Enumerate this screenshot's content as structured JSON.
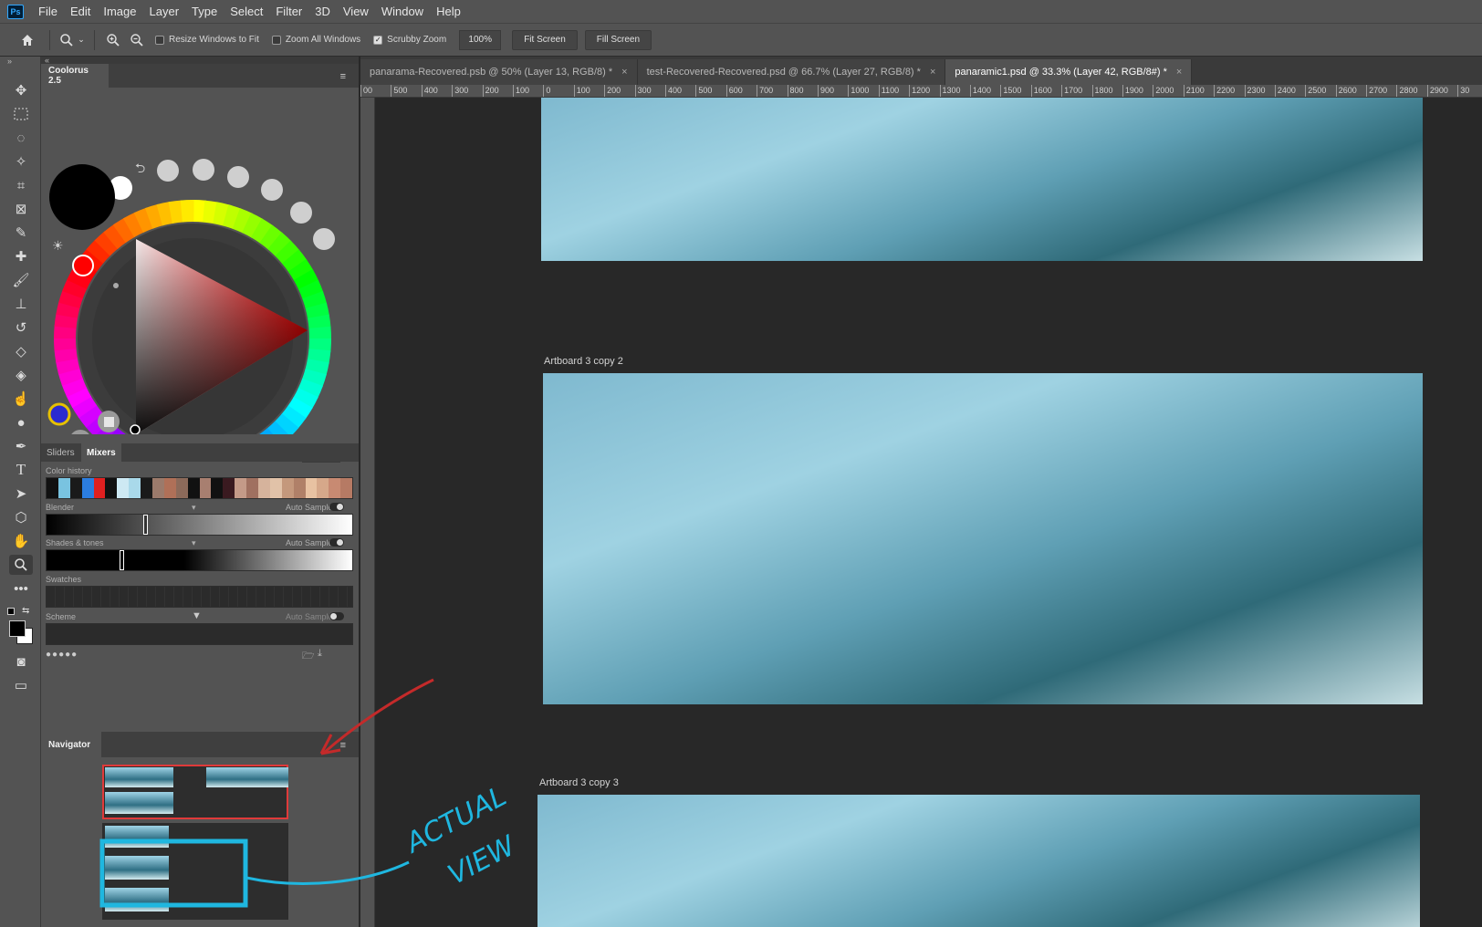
{
  "app": {
    "logo_text": "Ps"
  },
  "menu": [
    "File",
    "Edit",
    "Image",
    "Layer",
    "Type",
    "Select",
    "Filter",
    "3D",
    "View",
    "Window",
    "Help"
  ],
  "options": {
    "resize_windows": {
      "label": "Resize Windows to Fit",
      "checked": false
    },
    "zoom_all": {
      "label": "Zoom All Windows",
      "checked": false
    },
    "scrubby_zoom": {
      "label": "Scrubby Zoom",
      "checked": true
    },
    "zoom_value": "100%",
    "fit_screen": "Fit Screen",
    "fill_screen": "Fill Screen"
  },
  "panel_colourus": {
    "title": "Coolorus 2.5",
    "hex_prefix": "#",
    "hex_value": "000000",
    "tabs": [
      "Sliders",
      "Mixers"
    ],
    "active_tab": "Mixers",
    "color_history_label": "Color history",
    "blender_label": "Blender",
    "auto_sample": "Auto Sample",
    "shades_label": "Shades & tones",
    "swatches_label": "Swatches",
    "scheme_label": "Scheme"
  },
  "panel_navigator": {
    "title": "Navigator"
  },
  "doc_tabs": [
    {
      "label": "panarama-Recovered.psb @ 50% (Layer 13, RGB/8) *",
      "active": false
    },
    {
      "label": "test-Recovered-Recovered.psd @ 66.7% (Layer 27, RGB/8) *",
      "active": false
    },
    {
      "label": "panaramic1.psd @ 33.3% (Layer 42, RGB/8#) *",
      "active": true
    }
  ],
  "ruler_marks": [
    "00",
    "500",
    "400",
    "300",
    "200",
    "100",
    "0",
    "100",
    "200",
    "300",
    "400",
    "500",
    "600",
    "700",
    "800",
    "900",
    "1000",
    "1100",
    "1200",
    "1300",
    "1400",
    "1500",
    "1600",
    "1700",
    "1800",
    "1900",
    "2000",
    "2100",
    "2200",
    "2300",
    "2400",
    "2500",
    "2600",
    "2700",
    "2800",
    "2900",
    "30"
  ],
  "artboards": [
    {
      "label": "Artboard 3 copy 2"
    },
    {
      "label": "Artboard 3 copy 3"
    }
  ],
  "annotation": {
    "text_line1": "ACTUAL",
    "text_line2": "VIEW"
  },
  "colors": {
    "accent_red": "#e03030",
    "annotation_blue": "#1fb7e0",
    "foreground": "#000000",
    "background": "#ffffff"
  }
}
